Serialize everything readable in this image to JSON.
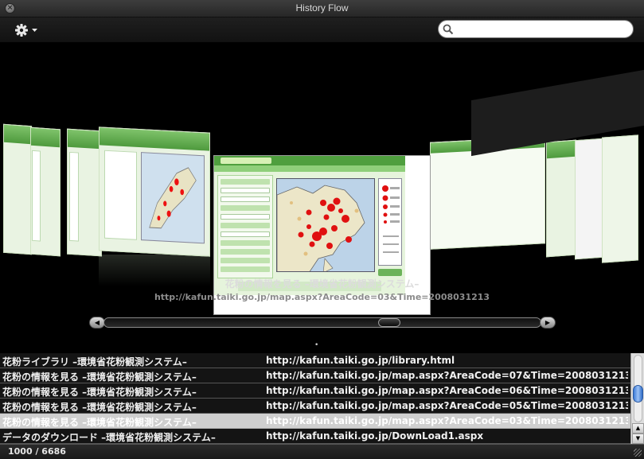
{
  "window": {
    "title": "History Flow"
  },
  "toolbar": {
    "gear_icon": "gear-icon",
    "search_placeholder": "",
    "search_value": ""
  },
  "coverflow": {
    "selected_title": "花粉の情報を見る –環境省花粉観測システム–",
    "selected_url": "http://kafun.taiki.go.jp/map.aspx?AreaCode=03&Time=2008031213",
    "scroll_position_fraction": 0.66,
    "indicator": "•"
  },
  "history": {
    "rows": [
      {
        "title": "花粉ライブラリ –環境省花粉観測システム–",
        "url": "http://kafun.taiki.go.jp/library.html",
        "selected": false
      },
      {
        "title": "花粉の情報を見る –環境省花粉観測システム–",
        "url": "http://kafun.taiki.go.jp/map.aspx?AreaCode=07&Time=2008031213",
        "selected": false
      },
      {
        "title": "花粉の情報を見る –環境省花粉観測システム–",
        "url": "http://kafun.taiki.go.jp/map.aspx?AreaCode=06&Time=2008031213",
        "selected": false
      },
      {
        "title": "花粉の情報を見る –環境省花粉観測システム–",
        "url": "http://kafun.taiki.go.jp/map.aspx?AreaCode=05&Time=2008031213",
        "selected": false
      },
      {
        "title": "花粉の情報を見る –環境省花粉観測システム–",
        "url": "http://kafun.taiki.go.jp/map.aspx?AreaCode=03&Time=2008031213",
        "selected": true
      },
      {
        "title": "データのダウンロード –環境省花粉観測システム–",
        "url": "http://kafun.taiki.go.jp/DownLoad1.aspx",
        "selected": false
      }
    ]
  },
  "status": {
    "count": "1000 / 6686"
  }
}
